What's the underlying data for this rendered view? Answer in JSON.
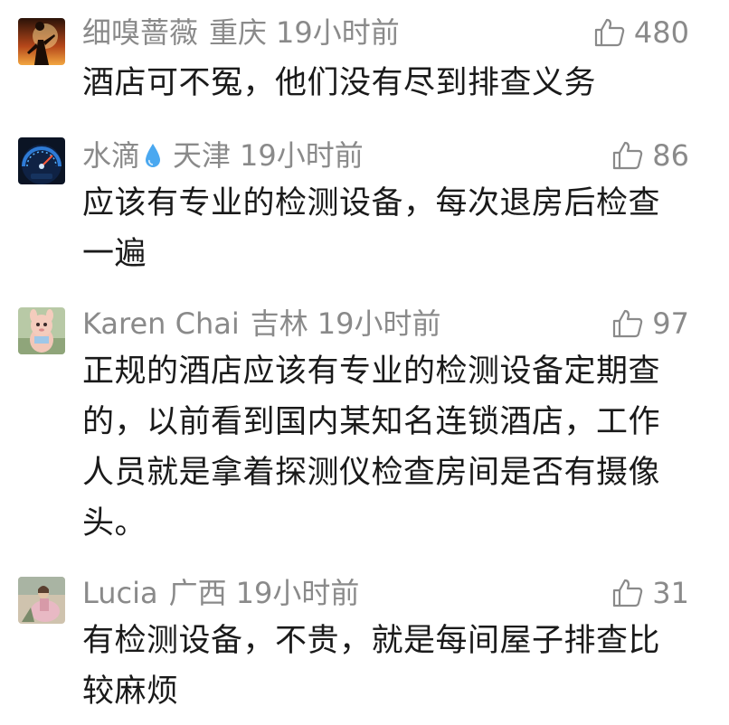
{
  "comments": [
    {
      "username": "细嗅蔷薇",
      "location": "重庆",
      "time": "19小时前",
      "likes": "480",
      "text": "酒店可不冤，他们没有尽到排查义务",
      "avatar_icon": "ninja-silhouette-avatar"
    },
    {
      "username": "水滴",
      "username_icon": "water-drop-icon",
      "location": "天津",
      "time": "19小时前",
      "likes": "86",
      "text": "应该有专业的检测设备，每次退房后检查一遍",
      "avatar_icon": "car-dashboard-avatar"
    },
    {
      "username": "Karen Chai",
      "location": "吉林",
      "time": "19小时前",
      "likes": "97",
      "text": "正规的酒店应该有专业的检测设备定期查的，以前看到国内某知名连锁酒店，工作人员就是拿着探测仪检查房间是否有摄像头。",
      "avatar_icon": "plush-toy-avatar"
    },
    {
      "username": "Lucia",
      "location": "广西",
      "time": "19小时前",
      "likes": "31",
      "text": "有检测设备，不贵，就是每间屋子排查比较麻烦",
      "avatar_icon": "painting-avatar"
    }
  ],
  "colors": {
    "meta_text": "#8a8a8a",
    "body_text": "#1a1a1a",
    "drop_blue": "#4aa8f0",
    "background": "#ffffff"
  }
}
